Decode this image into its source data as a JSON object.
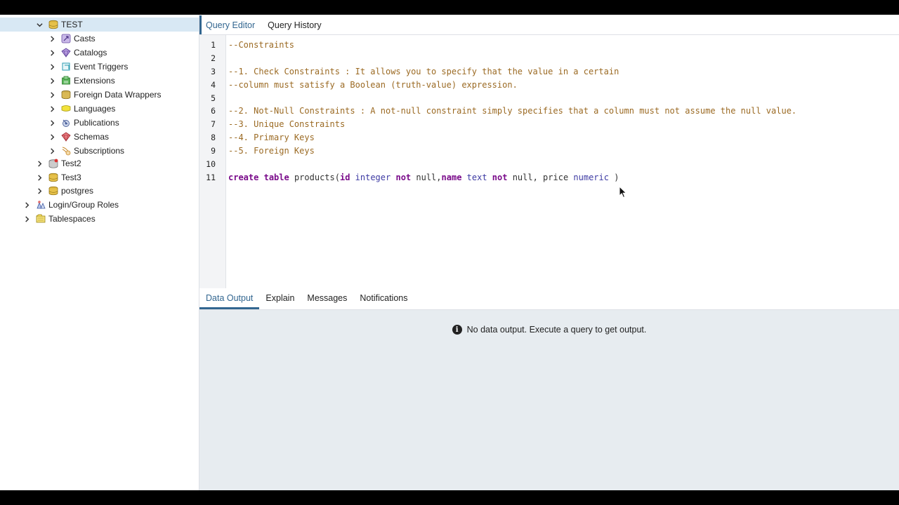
{
  "sidebar": {
    "items": [
      {
        "label": "TEST",
        "expanded": true,
        "icon": "database-icon"
      },
      {
        "label": "Casts",
        "icon": "casts-icon"
      },
      {
        "label": "Catalogs",
        "icon": "catalogs-icon"
      },
      {
        "label": "Event Triggers",
        "icon": "event-triggers-icon"
      },
      {
        "label": "Extensions",
        "icon": "extensions-icon"
      },
      {
        "label": "Foreign Data Wrappers",
        "icon": "foreign-data-wrappers-icon"
      },
      {
        "label": "Languages",
        "icon": "languages-icon"
      },
      {
        "label": "Publications",
        "icon": "publications-icon"
      },
      {
        "label": "Schemas",
        "icon": "schemas-icon"
      },
      {
        "label": "Subscriptions",
        "icon": "subscriptions-icon"
      },
      {
        "label": "Test2",
        "icon": "database-disconnected-icon"
      },
      {
        "label": "Test3",
        "icon": "database-icon"
      },
      {
        "label": "postgres",
        "icon": "database-icon"
      },
      {
        "label": "Login/Group Roles",
        "icon": "roles-icon"
      },
      {
        "label": "Tablespaces",
        "icon": "tablespaces-icon"
      }
    ]
  },
  "editor": {
    "tabs": [
      "Query Editor",
      "Query History"
    ],
    "active_tab": "Query Editor",
    "line_numbers": [
      "1",
      "2",
      "3",
      "4",
      "5",
      "6",
      "7",
      "8",
      "9",
      "10",
      "11"
    ],
    "lines": {
      "l1": "--Constraints",
      "l3": "--1. Check Constraints : It allows you to specify that the value in a certain",
      "l4": "--column must satisfy a Boolean (truth-value) expression.",
      "l6": "--2. Not-Null Constraints : A not-null constraint simply specifies that a column must not assume the null value.",
      "l7": "--3. Unique Constraints",
      "l8": "--4. Primary Keys",
      "l9": "--5. Foreign Keys",
      "l11": {
        "t1": "create",
        "t2": " ",
        "t3": "table",
        "t4": " products(",
        "t5": "id",
        "t6": " ",
        "t7": "integer",
        "t8": " ",
        "t9": "not",
        "t10": " null,",
        "t11": "name",
        "t12": " ",
        "t13": "text",
        "t14": " ",
        "t15": "not",
        "t16": " null, price ",
        "t17": "numeric",
        "t18": " )"
      }
    }
  },
  "output": {
    "tabs": [
      "Data Output",
      "Explain",
      "Messages",
      "Notifications"
    ],
    "active_tab": "Data Output",
    "message": "No data output. Execute a query to get output.",
    "info_glyph": "i"
  },
  "colors": {
    "accent": "#326690",
    "selected_row": "#d8e8f4",
    "comment": "#9b6a23",
    "keyword": "#7a0b8a",
    "type": "#3d3aa3",
    "output_bg": "#e7ecf0"
  }
}
